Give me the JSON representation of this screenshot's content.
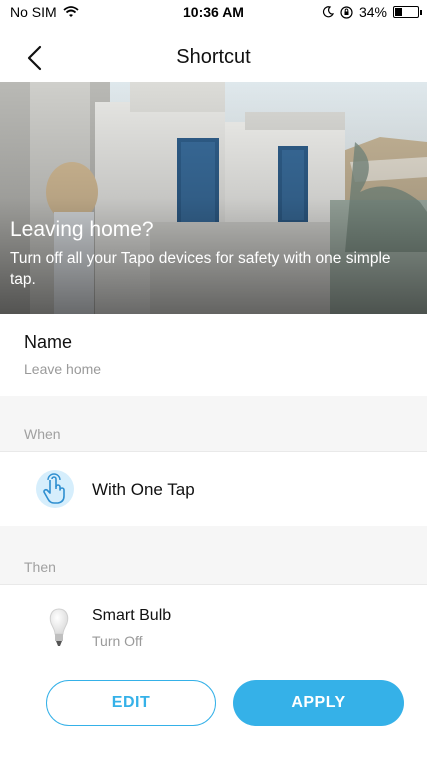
{
  "status_bar": {
    "carrier": "No SIM",
    "time": "10:36 AM",
    "battery": "34%",
    "battery_level": 0.34
  },
  "nav": {
    "title": "Shortcut",
    "back_icon": "chevron-left-icon"
  },
  "hero": {
    "title": "Leaving home?",
    "subtitle": "Turn off all your Tapo devices for safety with one simple tap."
  },
  "name": {
    "label": "Name",
    "value": "Leave home"
  },
  "when": {
    "header": "When",
    "trigger_label": "With One Tap",
    "trigger_icon": "hand-tap-icon"
  },
  "then": {
    "header": "Then",
    "device_name": "Smart Bulb",
    "action": "Turn Off",
    "device_icon": "bulb-icon"
  },
  "buttons": {
    "edit": "EDIT",
    "apply": "APPLY"
  },
  "colors": {
    "accent": "#35b1e8",
    "icon_bg": "#d6eefc"
  }
}
